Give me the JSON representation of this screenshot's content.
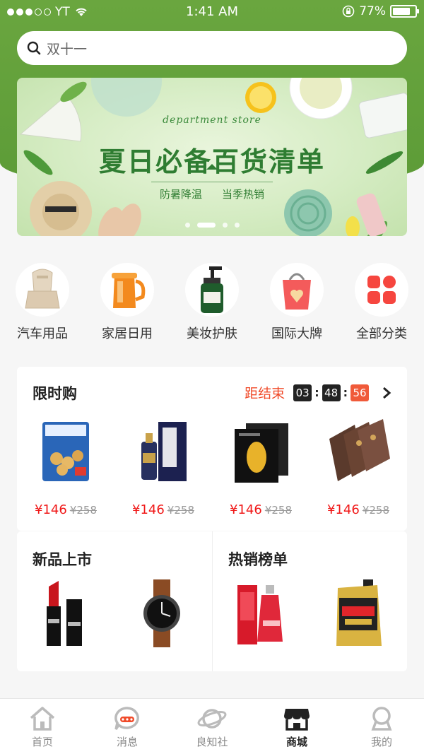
{
  "status": {
    "carrier": "YT",
    "time": "1:41 AM",
    "battery": "77%"
  },
  "search": {
    "placeholder": "双十一"
  },
  "banner": {
    "subtitle": "department store",
    "title": "夏日必备百货清单",
    "tag1": "防暑降温",
    "tag2": "当季热销"
  },
  "categories": [
    {
      "label": "汽车用品",
      "icon": "car-seat-icon"
    },
    {
      "label": "家居日用",
      "icon": "kettle-icon"
    },
    {
      "label": "美妆护肤",
      "icon": "lotion-bottle-icon"
    },
    {
      "label": "国际大牌",
      "icon": "shopping-bag-icon"
    },
    {
      "label": "全部分类",
      "icon": "grid-icon"
    }
  ],
  "flash_sale": {
    "title": "限时购",
    "countdown_label": "距结束",
    "hours": "03",
    "minutes": "48",
    "seconds": "56",
    "items": [
      {
        "price": "¥146",
        "old_price": "¥258"
      },
      {
        "price": "¥146",
        "old_price": "¥258"
      },
      {
        "price": "¥146",
        "old_price": "¥258"
      },
      {
        "price": "¥146",
        "old_price": "¥258"
      }
    ]
  },
  "new_arrivals": {
    "title": "新品上市"
  },
  "best_sellers": {
    "title": "热销榜单"
  },
  "tabbar": [
    {
      "label": "首页",
      "icon": "home-icon"
    },
    {
      "label": "消息",
      "icon": "message-icon"
    },
    {
      "label": "良知社",
      "icon": "planet-icon"
    },
    {
      "label": "商城",
      "icon": "store-icon",
      "active": true
    },
    {
      "label": "我的",
      "icon": "profile-icon"
    }
  ],
  "colors": {
    "green": "#5c9b37",
    "red": "#f01818",
    "countdown": "#f04b2a"
  }
}
